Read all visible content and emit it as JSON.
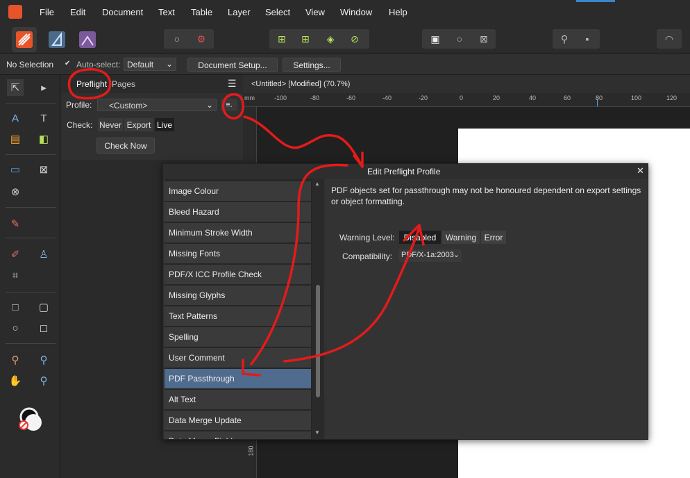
{
  "menu": [
    "File",
    "Edit",
    "Document",
    "Text",
    "Table",
    "Layer",
    "Select",
    "View",
    "Window",
    "Help"
  ],
  "context": {
    "selection": "No Selection",
    "autoselect_label": "Auto-select:",
    "autoselect_value": "Default",
    "doc_setup": "Document Setup...",
    "settings": "Settings..."
  },
  "panel": {
    "tab_preflight": "Preflight",
    "tab_pages": "Pages",
    "profile_label": "Profile:",
    "profile_value": "<Custom>",
    "check_label": "Check:",
    "check_options": [
      "Never",
      "Export",
      "Live"
    ],
    "check_now": "Check Now"
  },
  "document": {
    "title": "<Untitled> [Modified] (70.7%)",
    "ruler_unit": "mm",
    "ruler_labels": [
      "-100",
      "-80",
      "-60",
      "-40",
      "-20",
      "0",
      "20",
      "40",
      "60",
      "80",
      "100",
      "120"
    ],
    "vruler_label": "180"
  },
  "dialog": {
    "title": "Edit Preflight Profile",
    "close": "✕",
    "checks": [
      "Image Colour",
      "Bleed Hazard",
      "Minimum Stroke Width",
      "Missing Fonts",
      "PDF/X ICC Profile Check",
      "Missing Glyphs",
      "Text Patterns",
      "Spelling",
      "User Comment",
      "PDF Passthrough",
      "Alt Text",
      "Data Merge Update",
      "Data Merge Fields"
    ],
    "selected_index": 9,
    "description": "PDF objects set for passthrough may not be honoured dependent on export settings or object formatting.",
    "warning_level_label": "Warning Level:",
    "warning_levels": [
      "Disabled",
      "Warning",
      "Error"
    ],
    "compatibility_label": "Compatibility:",
    "compatibility_value": "PDF/X-1a:2003"
  },
  "colors": {
    "accent_selection": "#4f6b8e",
    "annotation_red": "#e31b1b",
    "app_logo": "#e8542a"
  }
}
